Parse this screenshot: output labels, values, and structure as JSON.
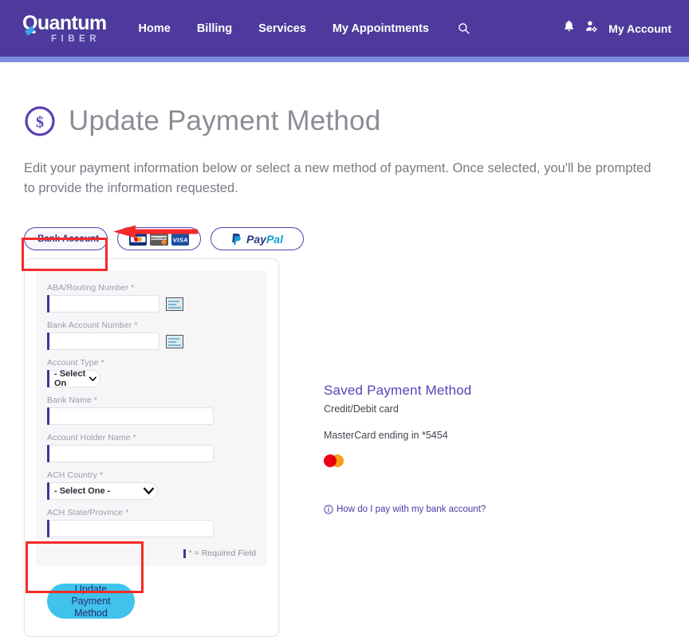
{
  "header": {
    "logo_main": "Quantum",
    "logo_sub": "FIBER",
    "nav": [
      {
        "label": "Home",
        "name": "nav-home"
      },
      {
        "label": "Billing",
        "name": "nav-billing"
      },
      {
        "label": "Services",
        "name": "nav-services"
      },
      {
        "label": "My Appointments",
        "name": "nav-my-appointments"
      }
    ],
    "search_icon": "search-icon",
    "bell_icon": "notification-bell-icon",
    "account_icon": "account-settings-icon",
    "account_label": "My Account",
    "bar_color": "#4d3a9c",
    "accent_color": "#7b8ce0"
  },
  "page": {
    "icon": "dollar-circle-icon",
    "title": "Update Payment Method",
    "description": "Edit your payment information below or select a new method of payment. Once selected, you'll be prompted to provide the information requested."
  },
  "tabs": [
    {
      "name": "tab-bank-account",
      "label": "Bank Account",
      "icon": "bank-building-icon",
      "selected": true
    },
    {
      "name": "tab-credit-debit-card",
      "label": "",
      "cards": [
        "MasterCard",
        "Discover",
        "VISA"
      ],
      "selected": false
    },
    {
      "name": "tab-paypal",
      "label": "PayPal",
      "icon": "paypal-icon",
      "selected": false
    }
  ],
  "form": {
    "fields": [
      {
        "name": "aba-routing-number",
        "label": "ABA/Routing Number *",
        "value": "",
        "type": "text",
        "has_check_icon": true
      },
      {
        "name": "bank-account-number",
        "label": "Bank Account Number *",
        "value": "",
        "type": "text",
        "has_check_icon": true
      },
      {
        "name": "account-type",
        "label": "Account Type *",
        "value": "- Select On",
        "type": "select"
      },
      {
        "name": "bank-name",
        "label": "Bank Name *",
        "value": "",
        "type": "text"
      },
      {
        "name": "account-holder-name",
        "label": "Account Holder Name *",
        "value": "",
        "type": "text"
      },
      {
        "name": "ach-country",
        "label": "ACH Country *",
        "value": "- Select One -",
        "type": "select"
      },
      {
        "name": "ach-state-province",
        "label": "ACH State/Province *",
        "value": "",
        "type": "text"
      }
    ],
    "required_note": "* = Required Field",
    "submit_label": "Update Payment Method",
    "submit_color": "#3fc3ec"
  },
  "saved": {
    "title": "Saved Payment Method",
    "subtitle": "Credit/Debit card",
    "card_line": "MasterCard ending in *5454",
    "card_logo": "mastercard-logo",
    "help_link": "How do I pay with my bank account?",
    "help_icon": "info-circle-icon"
  },
  "annotations": {
    "color": "#f42a2a",
    "box_tab": "highlight-bank-account-tab",
    "box_button": "highlight-update-payment-method-button",
    "arrow": "red-arrow-pointing-left"
  }
}
